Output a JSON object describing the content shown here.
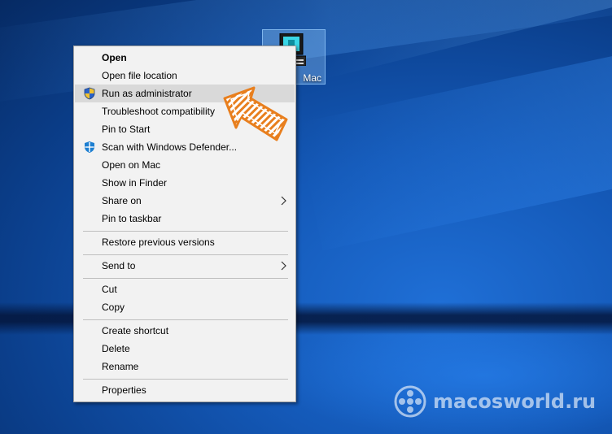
{
  "desktop_icon": {
    "label": "Mac",
    "icon": "application-icon"
  },
  "context_menu": {
    "items": [
      {
        "label": "Open",
        "bold": true
      },
      {
        "label": "Open file location"
      },
      {
        "label": "Run as administrator",
        "icon": "uac-shield-icon",
        "highlighted": true
      },
      {
        "label": "Troubleshoot compatibility"
      },
      {
        "label": "Pin to Start"
      },
      {
        "label": "Scan with Windows Defender...",
        "icon": "windows-defender-icon"
      },
      {
        "label": "Open on Mac"
      },
      {
        "label": "Show in Finder"
      },
      {
        "label": "Share on",
        "submenu": true
      },
      {
        "label": "Pin to taskbar"
      },
      {
        "label": "Restore previous versions"
      },
      {
        "label": "Send to",
        "submenu": true
      },
      {
        "label": "Cut"
      },
      {
        "label": "Copy"
      },
      {
        "label": "Create shortcut"
      },
      {
        "label": "Delete"
      },
      {
        "label": "Rename"
      },
      {
        "label": "Properties"
      }
    ]
  },
  "annotation": {
    "icon": "pointer-arrow-icon",
    "color": "#e87f1e"
  },
  "watermark": {
    "text": "macosworld.ru",
    "icon": "film-reel-logo-icon"
  },
  "colors": {
    "menu_background": "#f2f2f2",
    "menu_highlight": "#d9d9d9",
    "desktop_blue": "#1459b8",
    "arrow_orange": "#e87f1e"
  }
}
